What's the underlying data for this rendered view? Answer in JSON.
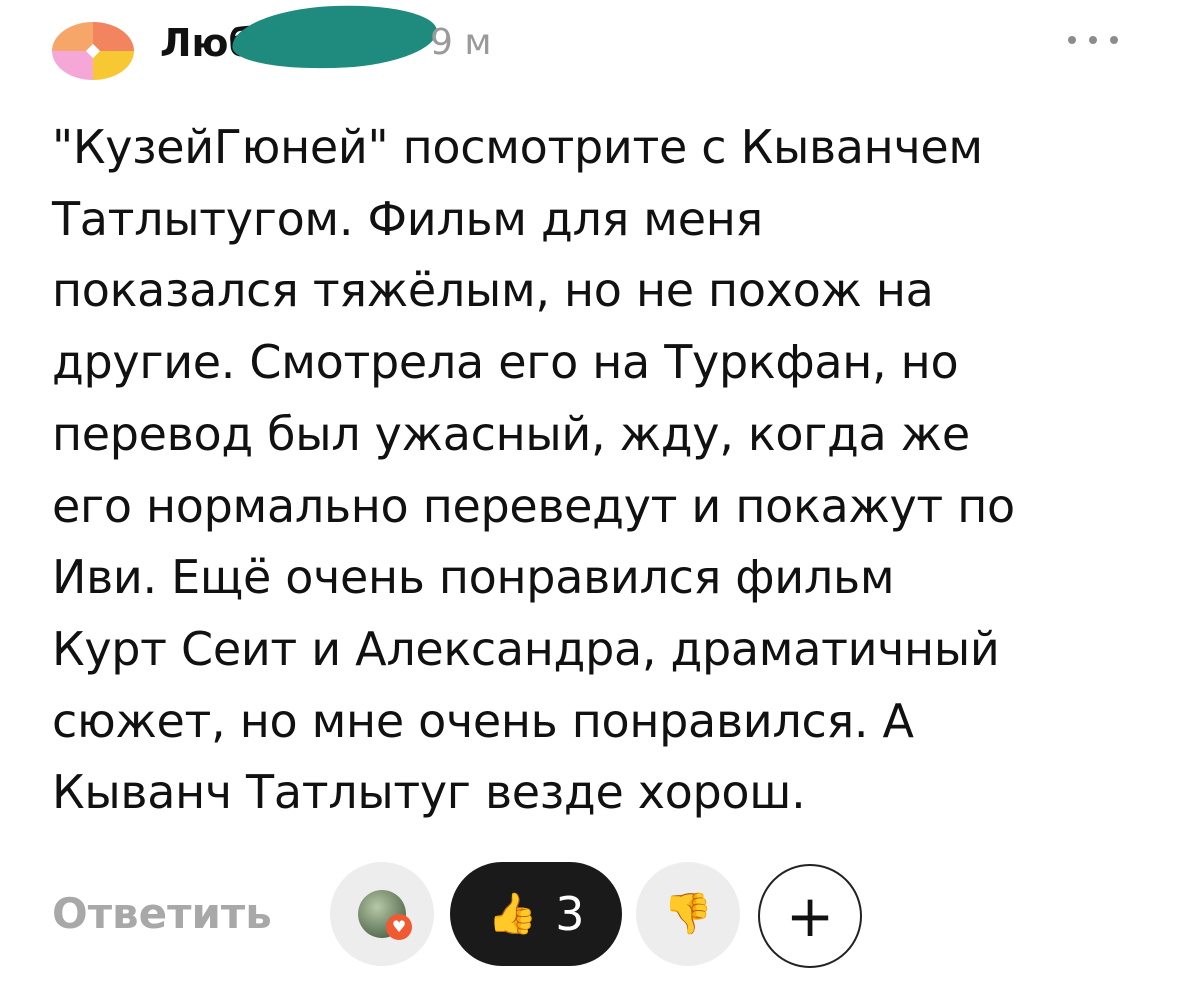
{
  "comment": {
    "author_visible": "Люб",
    "time": "9 м",
    "text_lines": [
      "\"КузейГюней\" посмотрите с Кыванчем",
      "Татлытугом. Фильм для меня",
      "показался тяжёлым, но не похож на",
      "другие. Смотрела его на Туркфан, но",
      "перевод был ужасный, жду, когда же",
      "его нормально переведут и покажут по",
      "Иви. Ещё очень понравился фильм",
      "Курт Сеит и Александра, драматичный",
      "сюжет, но мне очень понравился. А",
      "Кыванч Татлытуг везде хорош."
    ]
  },
  "actions": {
    "reply_label": "Ответить",
    "like_emoji": "👍",
    "like_count": "3",
    "dislike_emoji": "👎",
    "add_reaction_label": "+",
    "reactor_badge": "♥"
  },
  "icons": {
    "menu": "more-dots-icon",
    "avatar": "colorful-avatar",
    "like": "thumbs-up-icon",
    "dislike": "thumbs-down-icon",
    "add": "plus-icon"
  }
}
